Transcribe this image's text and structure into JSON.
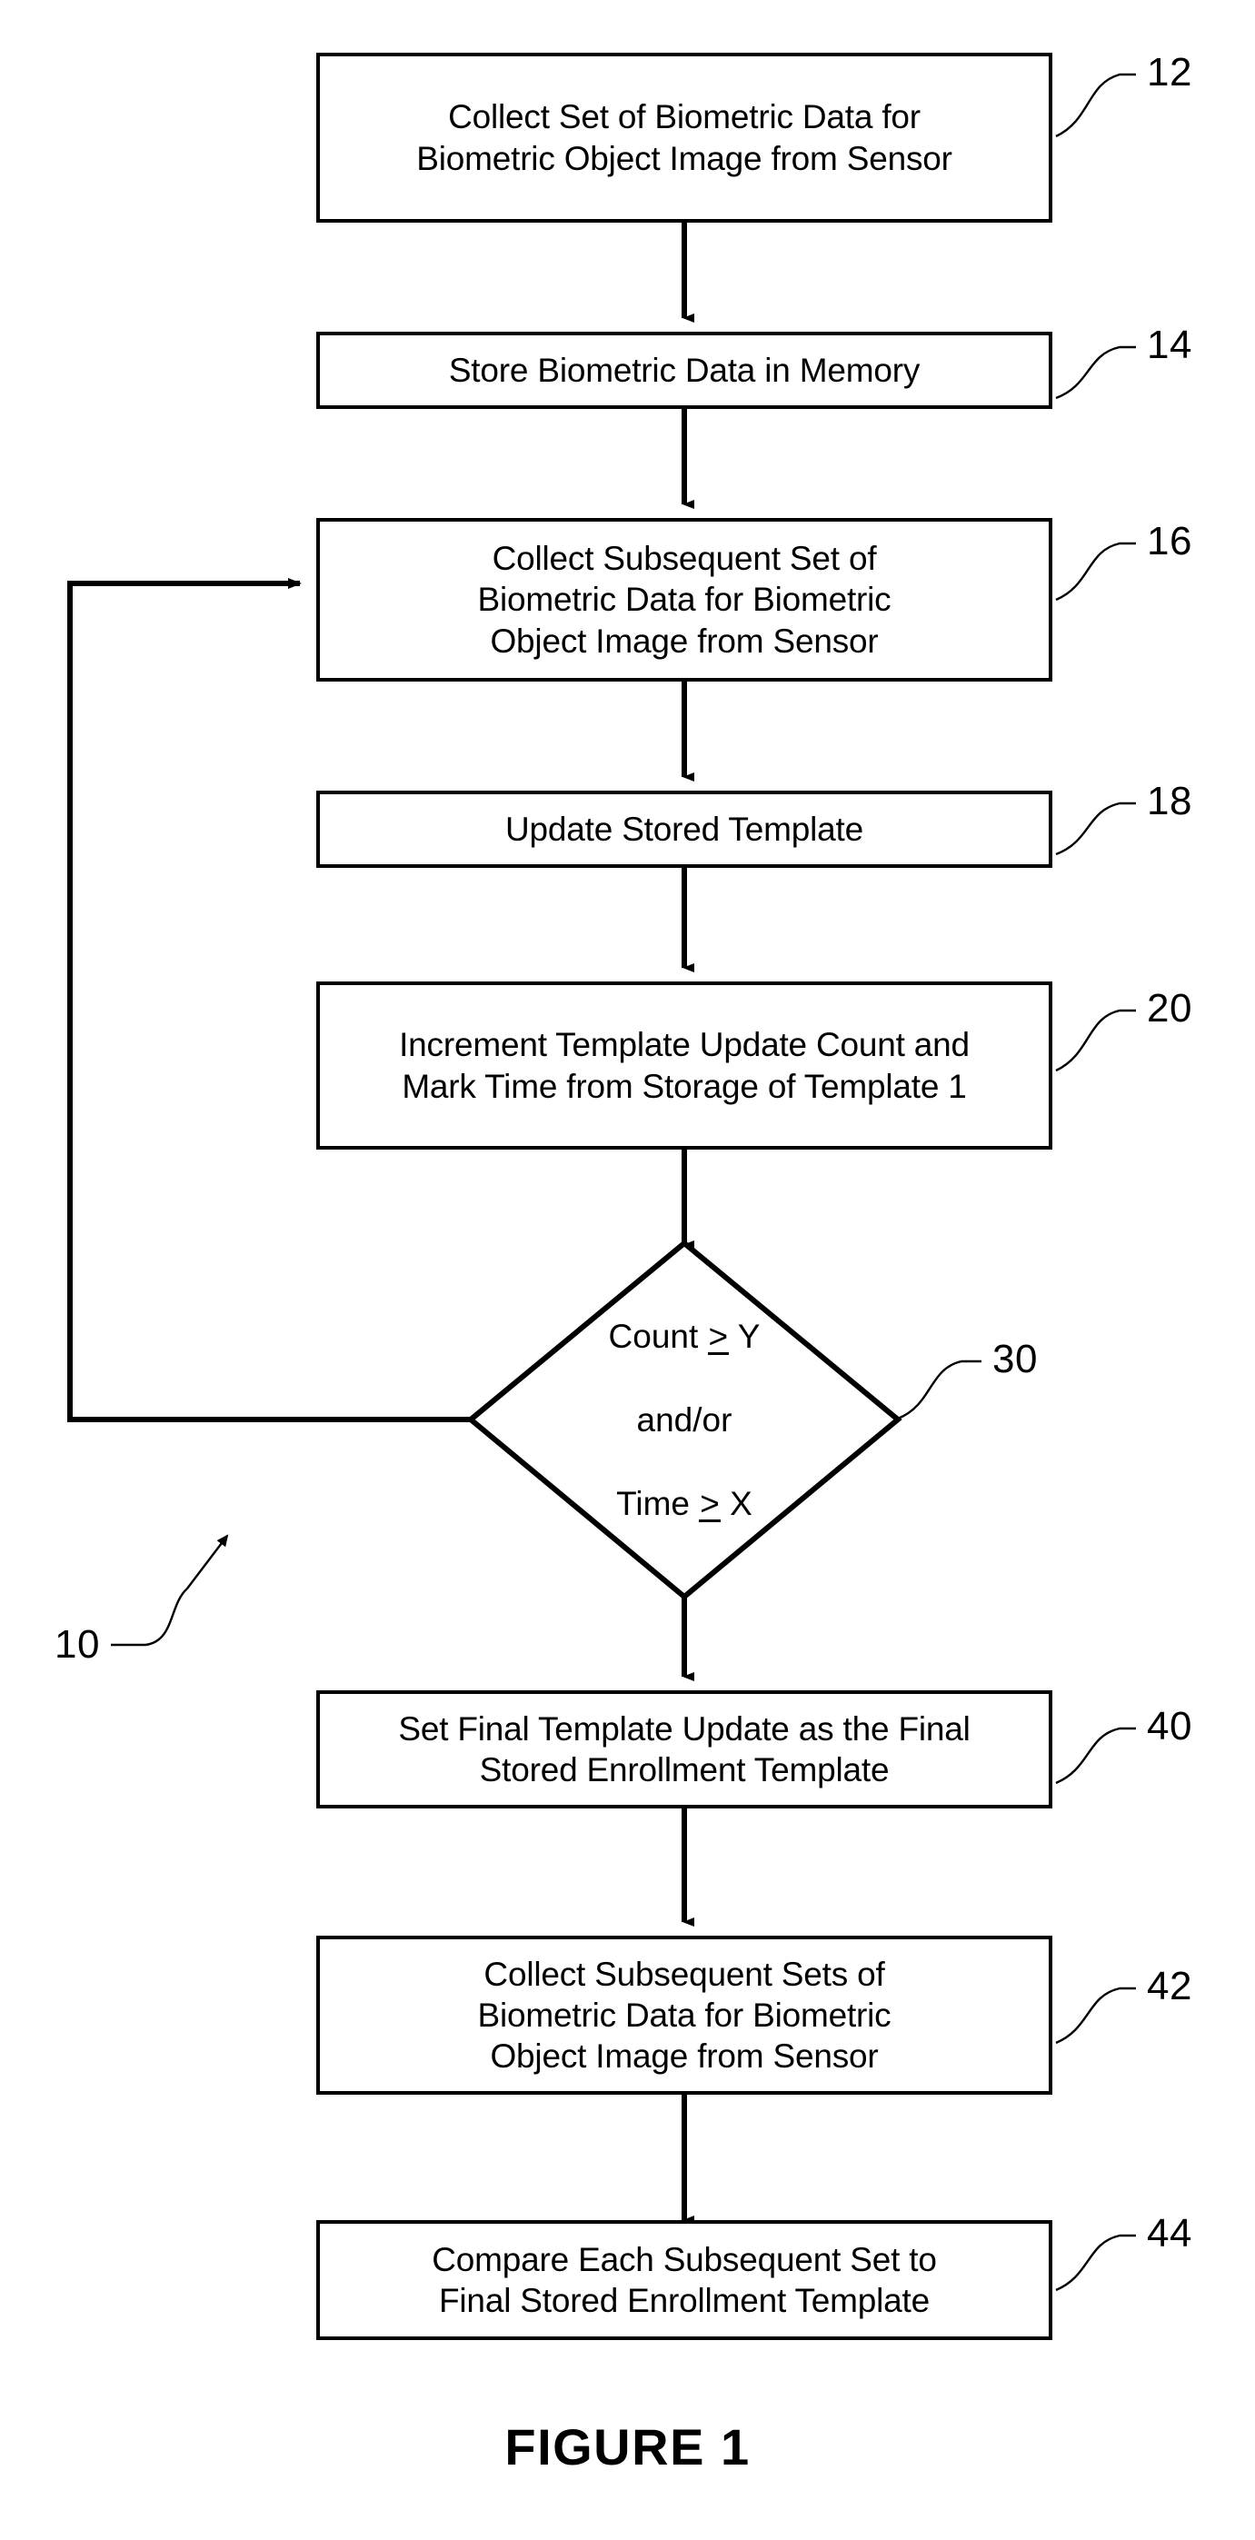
{
  "figure": {
    "caption": "FIGURE 1",
    "system_ref": "10"
  },
  "nodes": [
    {
      "id": "12",
      "ref": "12",
      "shape": "process",
      "text": "Collect Set of Biometric Data for\nBiometric Object Image from Sensor"
    },
    {
      "id": "14",
      "ref": "14",
      "shape": "process",
      "text": "Store Biometric Data in Memory"
    },
    {
      "id": "16",
      "ref": "16",
      "shape": "process",
      "text": "Collect Subsequent Set of\nBiometric Data for Biometric\nObject Image from Sensor"
    },
    {
      "id": "18",
      "ref": "18",
      "shape": "process",
      "text": "Update Stored Template"
    },
    {
      "id": "20",
      "ref": "20",
      "shape": "process",
      "text": "Increment Template Update Count and\nMark Time from Storage of Template 1"
    },
    {
      "id": "30",
      "ref": "30",
      "shape": "decision",
      "line1_pre": "Count ",
      "line1_op": ">",
      "line1_post": " Y",
      "line2": "and/or",
      "line3_pre": "Time ",
      "line3_op": ">",
      "line3_post": " X",
      "text": "Count ≥ Y and/or Time ≥ X"
    },
    {
      "id": "40",
      "ref": "40",
      "shape": "process",
      "text": "Set Final Template Update as the Final\nStored Enrollment Template"
    },
    {
      "id": "42",
      "ref": "42",
      "shape": "process",
      "text": "Collect Subsequent Sets of\nBiometric Data for Biometric\nObject Image from Sensor"
    },
    {
      "id": "44",
      "ref": "44",
      "shape": "process",
      "text": "Compare Each Subsequent Set to\nFinal Stored Enrollment Template"
    }
  ],
  "colors": {
    "stroke": "#000000",
    "background": "#ffffff",
    "text": "#000000"
  }
}
